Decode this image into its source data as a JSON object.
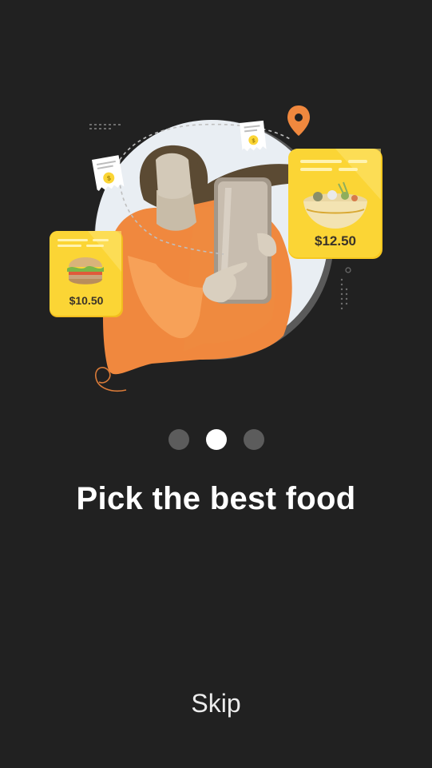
{
  "onboarding": {
    "title": "Pick the best food",
    "skip_label": "Skip",
    "page_indicator": {
      "total": 3,
      "active_index": 1
    },
    "cards": [
      {
        "item": "burger",
        "price": "$10.50"
      },
      {
        "item": "soup-bowl",
        "price": "$12.50"
      }
    ]
  },
  "colors": {
    "background": "#212121",
    "accent_orange": "#f0883e",
    "card_yellow": "#fbd535",
    "dot_inactive": "#5c5c5c",
    "dot_active": "#ffffff"
  },
  "icons": [
    "location-pin-icon",
    "receipt-dollar-icon",
    "receipt-dollar-icon"
  ]
}
